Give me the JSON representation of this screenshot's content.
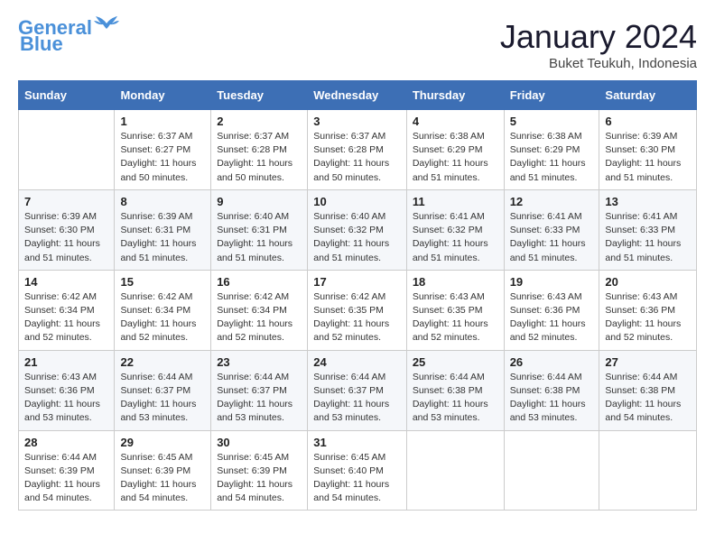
{
  "header": {
    "logo_line1": "General",
    "logo_line2": "Blue",
    "month": "January 2024",
    "location": "Buket Teukuh, Indonesia"
  },
  "weekdays": [
    "Sunday",
    "Monday",
    "Tuesday",
    "Wednesday",
    "Thursday",
    "Friday",
    "Saturday"
  ],
  "weeks": [
    [
      {
        "day": "",
        "info": ""
      },
      {
        "day": "1",
        "info": "Sunrise: 6:37 AM\nSunset: 6:27 PM\nDaylight: 11 hours\nand 50 minutes."
      },
      {
        "day": "2",
        "info": "Sunrise: 6:37 AM\nSunset: 6:28 PM\nDaylight: 11 hours\nand 50 minutes."
      },
      {
        "day": "3",
        "info": "Sunrise: 6:37 AM\nSunset: 6:28 PM\nDaylight: 11 hours\nand 50 minutes."
      },
      {
        "day": "4",
        "info": "Sunrise: 6:38 AM\nSunset: 6:29 PM\nDaylight: 11 hours\nand 51 minutes."
      },
      {
        "day": "5",
        "info": "Sunrise: 6:38 AM\nSunset: 6:29 PM\nDaylight: 11 hours\nand 51 minutes."
      },
      {
        "day": "6",
        "info": "Sunrise: 6:39 AM\nSunset: 6:30 PM\nDaylight: 11 hours\nand 51 minutes."
      }
    ],
    [
      {
        "day": "7",
        "info": "Sunrise: 6:39 AM\nSunset: 6:30 PM\nDaylight: 11 hours\nand 51 minutes."
      },
      {
        "day": "8",
        "info": "Sunrise: 6:39 AM\nSunset: 6:31 PM\nDaylight: 11 hours\nand 51 minutes."
      },
      {
        "day": "9",
        "info": "Sunrise: 6:40 AM\nSunset: 6:31 PM\nDaylight: 11 hours\nand 51 minutes."
      },
      {
        "day": "10",
        "info": "Sunrise: 6:40 AM\nSunset: 6:32 PM\nDaylight: 11 hours\nand 51 minutes."
      },
      {
        "day": "11",
        "info": "Sunrise: 6:41 AM\nSunset: 6:32 PM\nDaylight: 11 hours\nand 51 minutes."
      },
      {
        "day": "12",
        "info": "Sunrise: 6:41 AM\nSunset: 6:33 PM\nDaylight: 11 hours\nand 51 minutes."
      },
      {
        "day": "13",
        "info": "Sunrise: 6:41 AM\nSunset: 6:33 PM\nDaylight: 11 hours\nand 51 minutes."
      }
    ],
    [
      {
        "day": "14",
        "info": "Sunrise: 6:42 AM\nSunset: 6:34 PM\nDaylight: 11 hours\nand 52 minutes."
      },
      {
        "day": "15",
        "info": "Sunrise: 6:42 AM\nSunset: 6:34 PM\nDaylight: 11 hours\nand 52 minutes."
      },
      {
        "day": "16",
        "info": "Sunrise: 6:42 AM\nSunset: 6:34 PM\nDaylight: 11 hours\nand 52 minutes."
      },
      {
        "day": "17",
        "info": "Sunrise: 6:42 AM\nSunset: 6:35 PM\nDaylight: 11 hours\nand 52 minutes."
      },
      {
        "day": "18",
        "info": "Sunrise: 6:43 AM\nSunset: 6:35 PM\nDaylight: 11 hours\nand 52 minutes."
      },
      {
        "day": "19",
        "info": "Sunrise: 6:43 AM\nSunset: 6:36 PM\nDaylight: 11 hours\nand 52 minutes."
      },
      {
        "day": "20",
        "info": "Sunrise: 6:43 AM\nSunset: 6:36 PM\nDaylight: 11 hours\nand 52 minutes."
      }
    ],
    [
      {
        "day": "21",
        "info": "Sunrise: 6:43 AM\nSunset: 6:36 PM\nDaylight: 11 hours\nand 53 minutes."
      },
      {
        "day": "22",
        "info": "Sunrise: 6:44 AM\nSunset: 6:37 PM\nDaylight: 11 hours\nand 53 minutes."
      },
      {
        "day": "23",
        "info": "Sunrise: 6:44 AM\nSunset: 6:37 PM\nDaylight: 11 hours\nand 53 minutes."
      },
      {
        "day": "24",
        "info": "Sunrise: 6:44 AM\nSunset: 6:37 PM\nDaylight: 11 hours\nand 53 minutes."
      },
      {
        "day": "25",
        "info": "Sunrise: 6:44 AM\nSunset: 6:38 PM\nDaylight: 11 hours\nand 53 minutes."
      },
      {
        "day": "26",
        "info": "Sunrise: 6:44 AM\nSunset: 6:38 PM\nDaylight: 11 hours\nand 53 minutes."
      },
      {
        "day": "27",
        "info": "Sunrise: 6:44 AM\nSunset: 6:38 PM\nDaylight: 11 hours\nand 54 minutes."
      }
    ],
    [
      {
        "day": "28",
        "info": "Sunrise: 6:44 AM\nSunset: 6:39 PM\nDaylight: 11 hours\nand 54 minutes."
      },
      {
        "day": "29",
        "info": "Sunrise: 6:45 AM\nSunset: 6:39 PM\nDaylight: 11 hours\nand 54 minutes."
      },
      {
        "day": "30",
        "info": "Sunrise: 6:45 AM\nSunset: 6:39 PM\nDaylight: 11 hours\nand 54 minutes."
      },
      {
        "day": "31",
        "info": "Sunrise: 6:45 AM\nSunset: 6:40 PM\nDaylight: 11 hours\nand 54 minutes."
      },
      {
        "day": "",
        "info": ""
      },
      {
        "day": "",
        "info": ""
      },
      {
        "day": "",
        "info": ""
      }
    ]
  ]
}
